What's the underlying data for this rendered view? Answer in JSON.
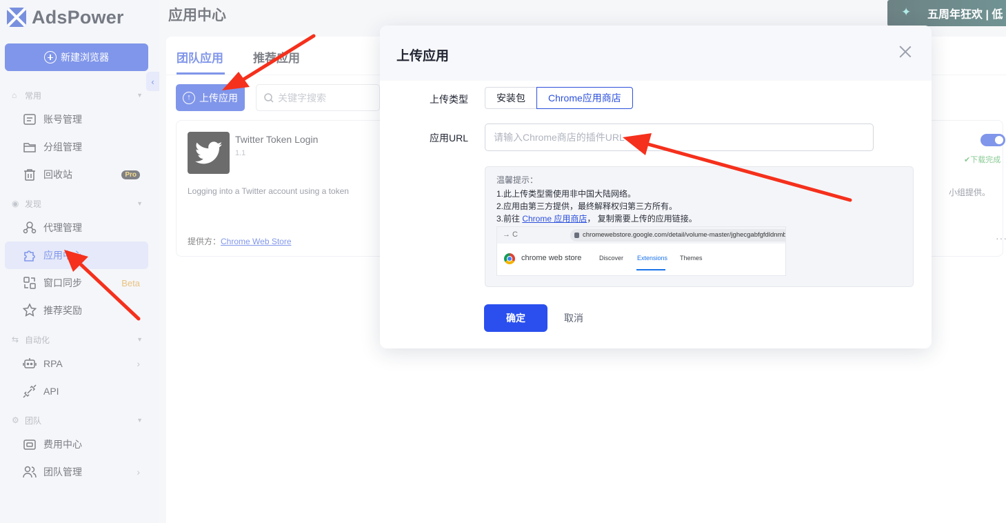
{
  "sidebar": {
    "logo_text": "AdsPower",
    "new_browser_label": "新建浏览器",
    "collapse_glyph": "‹",
    "sections": {
      "common": "常用",
      "discover": "发现",
      "automation": "自动化",
      "team": "团队"
    },
    "items": [
      {
        "label": "账号管理",
        "icon": "account-icon"
      },
      {
        "label": "分组管理",
        "icon": "folder-icon"
      },
      {
        "label": "回收站",
        "icon": "trash-icon",
        "badge": "Pro"
      },
      {
        "label": "代理管理",
        "icon": "proxy-icon"
      },
      {
        "label": "应用中心",
        "icon": "puzzle-icon",
        "active": true
      },
      {
        "label": "窗口同步",
        "icon": "window-sync-icon",
        "badge": "Beta"
      },
      {
        "label": "推荐奖励",
        "icon": "reward-icon"
      },
      {
        "label": "RPA",
        "icon": "robot-icon"
      },
      {
        "label": "API",
        "icon": "api-icon"
      },
      {
        "label": "费用中心",
        "icon": "wallet-icon"
      },
      {
        "label": "团队管理",
        "icon": "team-icon"
      }
    ]
  },
  "main": {
    "page_title": "应用中心",
    "promo_text": "五周年狂欢 | 低",
    "tabs": [
      "团队应用",
      "推荐应用"
    ],
    "upload_label": "上传应用",
    "search_placeholder": "关键字搜索",
    "app_card": {
      "name": "Twitter Token Login",
      "version": "1.1",
      "description": "Logging into a Twitter account using a token",
      "provider_label": "提供方：",
      "provider_link": "Chrome Web Store"
    },
    "right_card": {
      "download_status": "下载完成",
      "description_fragment": "小组提供。",
      "more": "···"
    }
  },
  "modal": {
    "title": "上传应用",
    "upload_type_label": "上传类型",
    "type_options": [
      "安装包",
      "Chrome应用商店"
    ],
    "selected_type": "Chrome应用商店",
    "url_label": "应用URL",
    "url_placeholder": "请输入Chrome商店的插件URL",
    "url_value": "",
    "tip": {
      "title": "温馨提示：",
      "line1": "1.此上传类型需使用非中国大陆网络。",
      "line2": "2.应用由第三方提供，最终解释权归第三方所有。",
      "line3_prefix": "3.前往 ",
      "line3_link": "Chrome 应用商店",
      "line3_suffix": "， 复制需要上传的应用链接。",
      "screenshot": {
        "nav_glyphs": "→   C",
        "url": "chromewebstore.google.com/detail/volume-master/jghecgabfgfdldnmbfkh",
        "brand": "chrome web store",
        "tabs": [
          "Discover",
          "Extensions",
          "Themes"
        ],
        "active_tab": "Extensions"
      }
    },
    "confirm_label": "确定",
    "cancel_label": "取消"
  },
  "colors": {
    "accent": "#2c50dc",
    "sidebar_bg": "#eef0f6",
    "annotation_arrow": "#f5301c",
    "success": "#3aa64a"
  }
}
